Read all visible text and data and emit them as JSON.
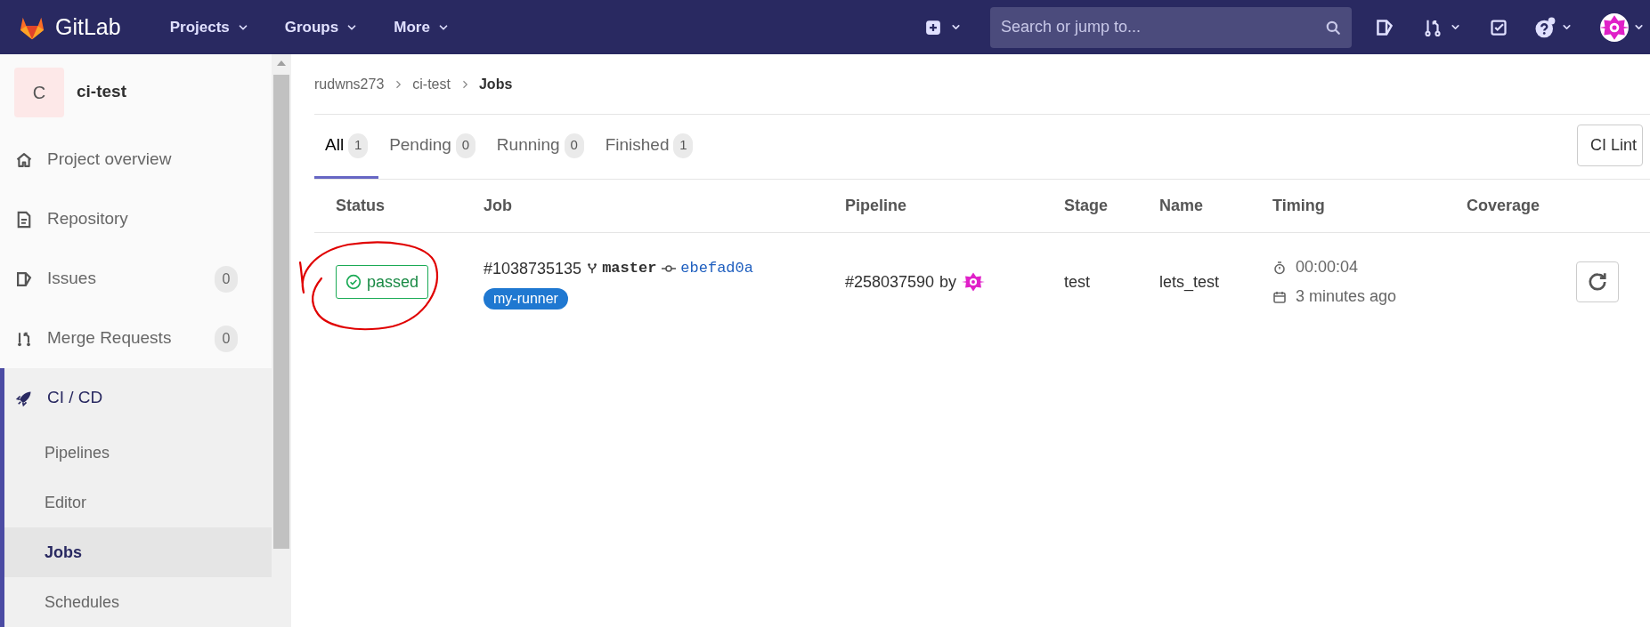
{
  "header": {
    "logo_text": "GitLab",
    "nav": [
      {
        "label": "Projects"
      },
      {
        "label": "Groups"
      },
      {
        "label": "More"
      }
    ],
    "search": {
      "placeholder": "Search or jump to..."
    }
  },
  "sidebar": {
    "project": {
      "avatar_letter": "C",
      "name": "ci-test"
    },
    "items": [
      {
        "label": "Project overview",
        "selected": false
      },
      {
        "label": "Repository",
        "selected": false
      },
      {
        "label": "Issues",
        "count": "0",
        "selected": false
      },
      {
        "label": "Merge Requests",
        "count": "0",
        "selected": false
      },
      {
        "label": "CI / CD",
        "selected": true,
        "children": [
          {
            "label": "Pipelines",
            "selected": false
          },
          {
            "label": "Editor",
            "selected": false
          },
          {
            "label": "Jobs",
            "selected": true
          },
          {
            "label": "Schedules",
            "selected": false
          }
        ]
      }
    ]
  },
  "breadcrumb": [
    "rudwns273",
    "ci-test",
    "Jobs"
  ],
  "tabs": [
    {
      "label": "All",
      "count": "1",
      "selected": true
    },
    {
      "label": "Pending",
      "count": "0",
      "selected": false
    },
    {
      "label": "Running",
      "count": "0",
      "selected": false
    },
    {
      "label": "Finished",
      "count": "1",
      "selected": false
    }
  ],
  "ci_lint_button": "CI Lint",
  "table": {
    "columns": [
      "Status",
      "Job",
      "Pipeline",
      "Stage",
      "Name",
      "Timing",
      "Coverage"
    ],
    "rows": [
      {
        "status": "passed",
        "job_id": "#1038735135",
        "branch": "master",
        "commit": "ebefad0a",
        "tag": "my-runner",
        "pipeline": "#258037590",
        "pipeline_by": "by",
        "stage": "test",
        "name": "lets_test",
        "duration": "00:00:04",
        "finished": "3 minutes ago"
      }
    ]
  }
}
